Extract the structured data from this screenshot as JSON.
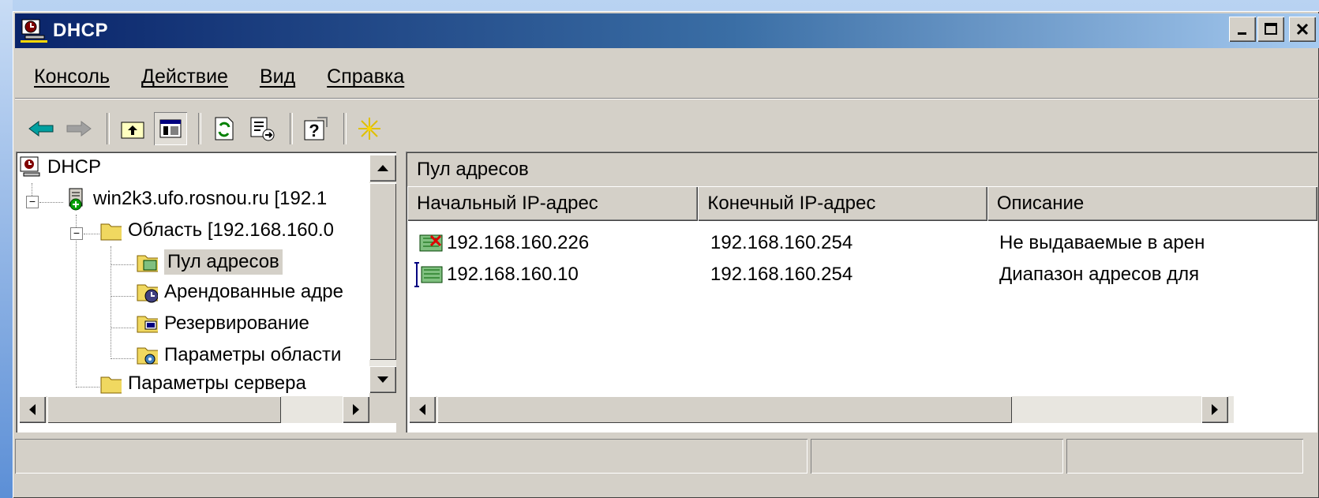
{
  "window": {
    "title": "DHCP"
  },
  "menu": [
    "Консоль",
    "Действие",
    "Вид",
    "Справка"
  ],
  "toolbar": {
    "icons": [
      "back-arrow-icon",
      "forward-arrow-icon",
      "up-folder-icon",
      "show-hide-tree-icon",
      "refresh-icon",
      "export-list-icon",
      "help-icon",
      "new-scope-star-icon"
    ]
  },
  "tree": {
    "root": "DHCP",
    "server": "win2k3.ufo.rosnou.ru [192.1",
    "scope": "Область [192.168.160.0",
    "children": [
      "Пул адресов",
      "Арендованные адре",
      "Резервирование",
      "Параметры области"
    ],
    "server_options": "Параметры сервера"
  },
  "right": {
    "title": "Пул адресов",
    "columns": [
      "Начальный IP-адрес",
      "Конечный IP-адрес",
      "Описание"
    ],
    "rows": [
      {
        "start": "192.168.160.226",
        "end": "192.168.160.254",
        "desc": "Не выдаваемые в арен",
        "icon": "excluded-range-icon"
      },
      {
        "start": "192.168.160.10",
        "end": "192.168.160.254",
        "desc": "Диапазон адресов для",
        "icon": "address-range-icon"
      }
    ]
  },
  "colors": {
    "title_start": "#0a246a",
    "title_end": "#a6caf0",
    "face": "#d4d0c8"
  }
}
